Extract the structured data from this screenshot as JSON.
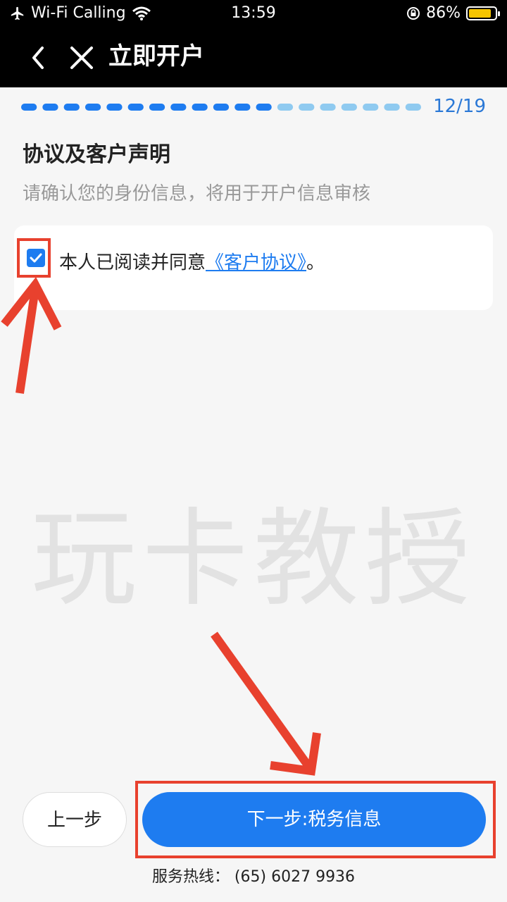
{
  "status_bar": {
    "carrier": "Wi-Fi Calling",
    "time": "13:59",
    "battery": "86%",
    "battery_level": 0.86
  },
  "nav": {
    "title": "立即开户",
    "back_icon": "chevron-left-icon",
    "close_icon": "close-icon"
  },
  "progress": {
    "current": 12,
    "total": 19,
    "label": "12/19"
  },
  "section": {
    "title": "协议及客户声明",
    "subtitle": "请确认您的身份信息，将用于开户信息审核"
  },
  "agreement": {
    "checked": true,
    "text": "本人已阅读并同意",
    "link": "《客户协议》",
    "suffix": "。"
  },
  "watermark": "玩卡教授",
  "buttons": {
    "prev": "上一步",
    "next": "下一步:税务信息"
  },
  "hotline": "服务热线： (65) 6027 9936",
  "colors": {
    "accent": "#1e7cf0",
    "annotation": "#e8412e",
    "progress_done": "#1e7cf0",
    "progress_todo": "#8fcaf0"
  }
}
